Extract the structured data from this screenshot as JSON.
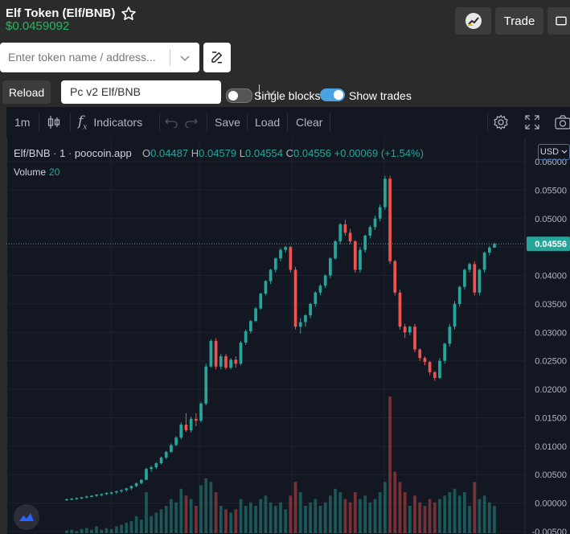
{
  "header": {
    "title": "Elf Token (Elf/BNB)",
    "price": "$0.0459092",
    "trade_label": "Trade"
  },
  "search": {
    "placeholder": "Enter token name / address..."
  },
  "controls": {
    "reload_label": "Reload",
    "pair_selected": "Pc v2 Elf/BNB",
    "single_blocks_label": "Single blocks",
    "single_blocks_on": false,
    "show_trades_label": "Show trades",
    "show_trades_on": true
  },
  "toolbar": {
    "interval": "1m",
    "indicators_label": "Indicators",
    "save_label": "Save",
    "load_label": "Load",
    "clear_label": "Clear"
  },
  "legend": {
    "symbol": "Elf/BNB",
    "interval": "1",
    "source": "poocoin.app",
    "o_label": "O",
    "o": "0.04487",
    "h_label": "H",
    "h": "0.04579",
    "l_label": "L",
    "l": "0.04554",
    "c_label": "C",
    "c": "0.04556",
    "change": "+0.00069 (+1.54%)",
    "volume_label": "Volume",
    "volume_value": "20"
  },
  "currency_button": "USD",
  "colors": {
    "up": "#26a69a",
    "down": "#ef5350",
    "price_green": "#28b463",
    "toggle_on": "#4aa3df"
  },
  "chart_data": {
    "type": "candlestick",
    "last_price_label": "0.04556",
    "y_ticks": [
      "0.06000",
      "0.05500",
      "0.05000",
      "0.04500",
      "0.04000",
      "0.03500",
      "0.03000",
      "0.02500",
      "0.02000",
      "0.01500",
      "0.01000",
      "0.00500",
      "0.00000",
      "-0.00500"
    ],
    "ylim": [
      -0.005,
      0.06
    ],
    "candles": [
      [
        0.0005,
        0.0008,
        0.0004,
        0.0007,
        0.08
      ],
      [
        0.0007,
        0.0009,
        0.0005,
        0.0008,
        0.1
      ],
      [
        0.0008,
        0.001,
        0.0006,
        0.0009,
        0.06
      ],
      [
        0.0009,
        0.0011,
        0.0007,
        0.001,
        0.12
      ],
      [
        0.001,
        0.0013,
        0.0008,
        0.0012,
        0.15
      ],
      [
        0.0012,
        0.0014,
        0.001,
        0.0013,
        0.1
      ],
      [
        0.0013,
        0.0016,
        0.0011,
        0.0015,
        0.2
      ],
      [
        0.0015,
        0.0017,
        0.0012,
        0.0016,
        0.1
      ],
      [
        0.0016,
        0.0019,
        0.0014,
        0.0018,
        0.15
      ],
      [
        0.0018,
        0.002,
        0.0015,
        0.0019,
        0.12
      ],
      [
        0.0019,
        0.0022,
        0.0016,
        0.0021,
        0.2
      ],
      [
        0.0021,
        0.0024,
        0.0018,
        0.0023,
        0.25
      ],
      [
        0.0023,
        0.0027,
        0.002,
        0.0026,
        0.3
      ],
      [
        0.0026,
        0.0031,
        0.0023,
        0.003,
        0.35
      ],
      [
        0.003,
        0.0036,
        0.0028,
        0.0035,
        0.5
      ],
      [
        0.0035,
        0.0042,
        0.0033,
        0.0041,
        0.4
      ],
      [
        0.0041,
        0.0062,
        0.004,
        0.006,
        1.2
      ],
      [
        0.006,
        0.0066,
        0.0055,
        0.0063,
        0.5
      ],
      [
        0.0063,
        0.0072,
        0.006,
        0.007,
        0.6
      ],
      [
        0.007,
        0.0082,
        0.0068,
        0.008,
        0.7
      ],
      [
        0.008,
        0.0092,
        0.0077,
        0.009,
        0.8
      ],
      [
        0.009,
        0.0105,
        0.0088,
        0.0102,
        1.0
      ],
      [
        0.0102,
        0.0118,
        0.01,
        0.0115,
        0.9
      ],
      [
        0.0115,
        0.0142,
        0.0112,
        0.0138,
        1.3
      ],
      [
        0.0138,
        0.0158,
        0.0125,
        0.0128,
        1.1
      ],
      [
        0.0128,
        0.0152,
        0.0124,
        0.0148,
        1.0
      ],
      [
        0.0148,
        0.0158,
        0.0135,
        0.0145,
        0.8
      ],
      [
        0.0145,
        0.0178,
        0.0142,
        0.0175,
        1.4
      ],
      [
        0.0175,
        0.0245,
        0.0172,
        0.024,
        1.6
      ],
      [
        0.024,
        0.0288,
        0.0238,
        0.0285,
        1.5
      ],
      [
        0.0285,
        0.029,
        0.0235,
        0.024,
        1.2
      ],
      [
        0.024,
        0.0262,
        0.0235,
        0.0258,
        0.8
      ],
      [
        0.0258,
        0.0262,
        0.0235,
        0.0238,
        0.7
      ],
      [
        0.0238,
        0.0255,
        0.0235,
        0.0252,
        0.6
      ],
      [
        0.0252,
        0.0258,
        0.0238,
        0.0245,
        0.7
      ],
      [
        0.0245,
        0.0285,
        0.0242,
        0.0282,
        1.0
      ],
      [
        0.0282,
        0.0305,
        0.0278,
        0.0302,
        0.8
      ],
      [
        0.0302,
        0.0322,
        0.0298,
        0.032,
        0.9
      ],
      [
        0.032,
        0.0345,
        0.0318,
        0.0342,
        0.8
      ],
      [
        0.0342,
        0.037,
        0.034,
        0.0368,
        1.0
      ],
      [
        0.0368,
        0.0392,
        0.0365,
        0.039,
        1.1
      ],
      [
        0.039,
        0.0412,
        0.0385,
        0.041,
        0.9
      ],
      [
        0.041,
        0.0432,
        0.0405,
        0.043,
        0.8
      ],
      [
        0.043,
        0.0448,
        0.0425,
        0.0445,
        0.9
      ],
      [
        0.0445,
        0.0452,
        0.044,
        0.045,
        0.7
      ],
      [
        0.045,
        0.0452,
        0.0405,
        0.041,
        1.1
      ],
      [
        0.041,
        0.0415,
        0.0305,
        0.031,
        1.5
      ],
      [
        0.031,
        0.0325,
        0.0298,
        0.0318,
        1.2
      ],
      [
        0.0318,
        0.0332,
        0.031,
        0.033,
        0.8
      ],
      [
        0.033,
        0.0352,
        0.0325,
        0.035,
        0.9
      ],
      [
        0.035,
        0.0372,
        0.0345,
        0.037,
        1.0
      ],
      [
        0.037,
        0.0385,
        0.0365,
        0.0382,
        0.8
      ],
      [
        0.0382,
        0.0402,
        0.0378,
        0.04,
        0.9
      ],
      [
        0.04,
        0.0432,
        0.0395,
        0.043,
        1.1
      ],
      [
        0.043,
        0.0462,
        0.0428,
        0.046,
        1.3
      ],
      [
        0.046,
        0.0492,
        0.0455,
        0.049,
        1.2
      ],
      [
        0.049,
        0.0498,
        0.047,
        0.0475,
        1.0
      ],
      [
        0.0475,
        0.0482,
        0.0455,
        0.046,
        0.9
      ],
      [
        0.046,
        0.0462,
        0.0405,
        0.041,
        1.2
      ],
      [
        0.041,
        0.045,
        0.0405,
        0.0445,
        1.0
      ],
      [
        0.0445,
        0.0472,
        0.044,
        0.047,
        1.1
      ],
      [
        0.047,
        0.0488,
        0.0465,
        0.0485,
        0.9
      ],
      [
        0.0485,
        0.0505,
        0.048,
        0.05,
        1.0
      ],
      [
        0.05,
        0.0525,
        0.0495,
        0.052,
        1.2
      ],
      [
        0.052,
        0.0575,
        0.0515,
        0.057,
        1.5
      ],
      [
        0.057,
        0.0575,
        0.042,
        0.0425,
        4.0
      ],
      [
        0.0425,
        0.0428,
        0.0365,
        0.037,
        1.8
      ],
      [
        0.037,
        0.0375,
        0.0305,
        0.031,
        1.5
      ],
      [
        0.031,
        0.0315,
        0.029,
        0.03,
        1.2
      ],
      [
        0.03,
        0.0312,
        0.0295,
        0.031,
        0.8
      ],
      [
        0.031,
        0.0315,
        0.0265,
        0.027,
        1.1
      ],
      [
        0.027,
        0.0272,
        0.025,
        0.0255,
        0.9
      ],
      [
        0.0255,
        0.0258,
        0.0242,
        0.0248,
        0.8
      ],
      [
        0.0248,
        0.025,
        0.0225,
        0.023,
        1.0
      ],
      [
        0.023,
        0.0232,
        0.0215,
        0.022,
        0.9
      ],
      [
        0.022,
        0.0255,
        0.0218,
        0.025,
        1.0
      ],
      [
        0.025,
        0.0282,
        0.0245,
        0.028,
        1.1
      ],
      [
        0.028,
        0.0315,
        0.0275,
        0.031,
        1.2
      ],
      [
        0.031,
        0.0355,
        0.0305,
        0.035,
        1.3
      ],
      [
        0.035,
        0.0382,
        0.0345,
        0.038,
        1.1
      ],
      [
        0.038,
        0.0412,
        0.0375,
        0.041,
        1.2
      ],
      [
        0.041,
        0.0422,
        0.0405,
        0.042,
        0.8
      ],
      [
        0.042,
        0.0425,
        0.0365,
        0.037,
        1.5
      ],
      [
        0.037,
        0.0412,
        0.0365,
        0.041,
        1.0
      ],
      [
        0.041,
        0.0442,
        0.0405,
        0.044,
        1.1
      ],
      [
        0.044,
        0.0452,
        0.0435,
        0.0449,
        0.9
      ],
      [
        0.04487,
        0.04579,
        0.04554,
        0.04556,
        0.8
      ]
    ]
  }
}
